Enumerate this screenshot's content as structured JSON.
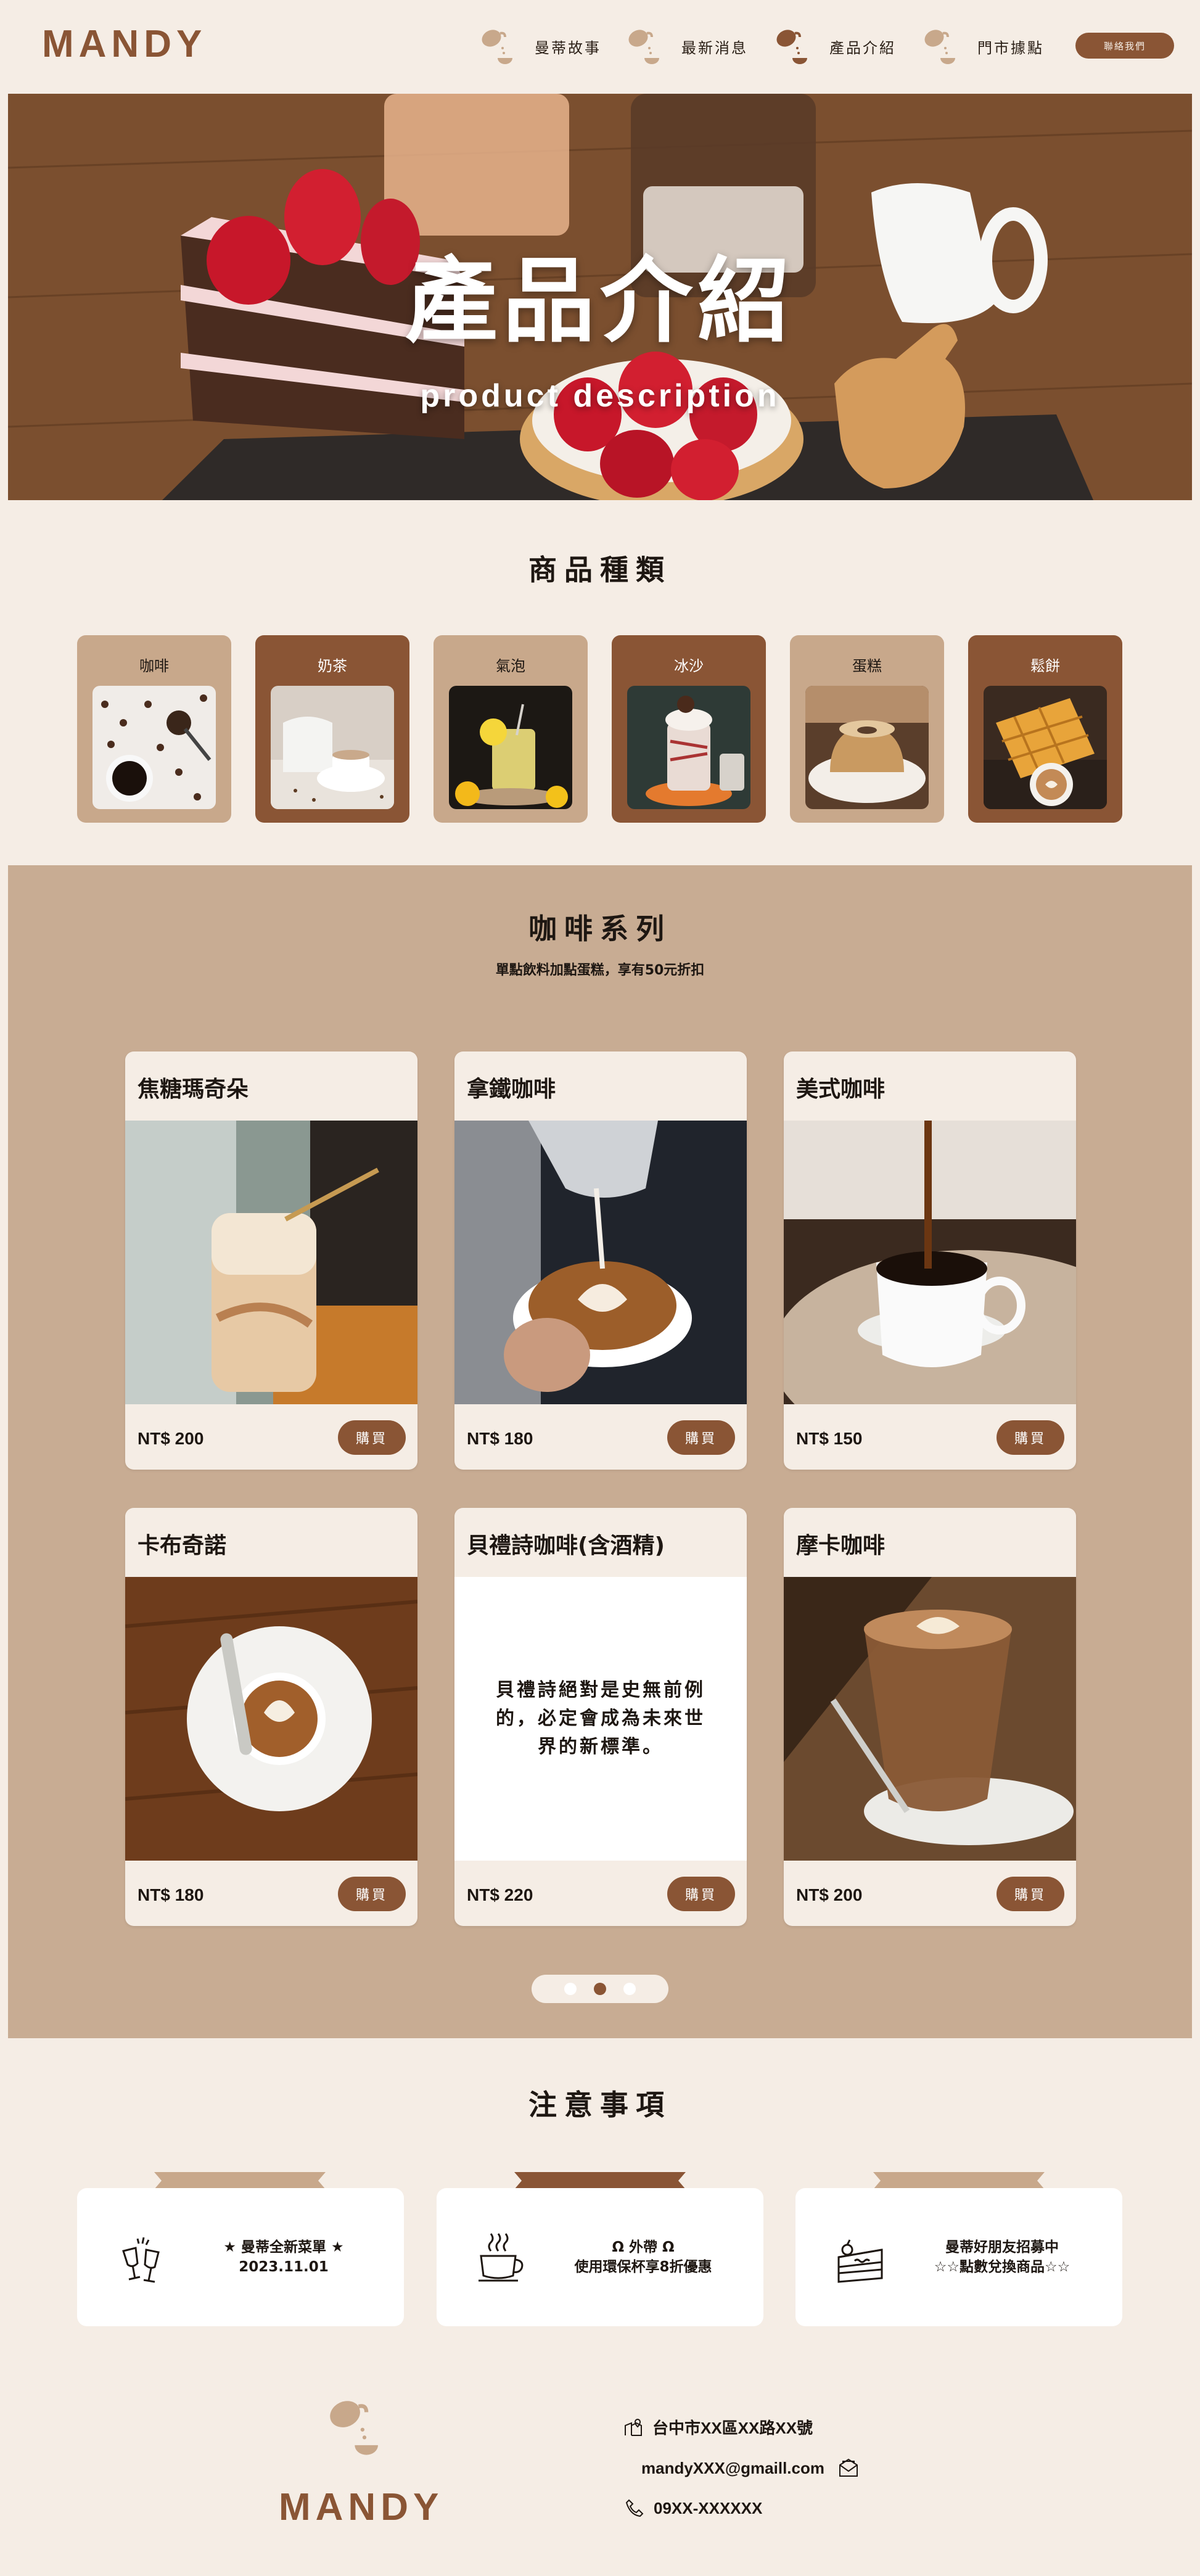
{
  "brand": {
    "logo": "MANDY"
  },
  "nav": {
    "items": [
      {
        "label": "曼蒂故事",
        "icon": "coffee-pour-icon"
      },
      {
        "label": "最新消息",
        "icon": "coffee-pour-icon"
      },
      {
        "label": "產品介紹",
        "icon": "coffee-pour-icon"
      },
      {
        "label": "門市據點",
        "icon": "coffee-pour-icon"
      }
    ],
    "contact_label": "聯絡我們"
  },
  "hero": {
    "title": "產品介紹",
    "subtitle": "product description"
  },
  "categories": {
    "title": "商品種類",
    "items": [
      {
        "label": "咖啡",
        "style": "light"
      },
      {
        "label": "奶茶",
        "style": "dark"
      },
      {
        "label": "氣泡",
        "style": "light"
      },
      {
        "label": "冰沙",
        "style": "dark"
      },
      {
        "label": "蛋糕",
        "style": "light"
      },
      {
        "label": "鬆餅",
        "style": "dark"
      }
    ]
  },
  "coffee": {
    "title": "咖啡系列",
    "note": "單點飲料加點蛋糕，享有50元折扣",
    "buy_label": "購買",
    "products": [
      {
        "name": "焦糖瑪奇朵",
        "price": "NT$ 200"
      },
      {
        "name": "拿鐵咖啡",
        "price": "NT$ 180"
      },
      {
        "name": "美式咖啡",
        "price": "NT$ 150"
      },
      {
        "name": "卡布奇諾",
        "price": "NT$ 180"
      },
      {
        "name": "貝禮詩咖啡(含酒精)",
        "price": "NT$ 220",
        "description": "貝禮詩絕對是史無前例的，必定會成為未來世界的新標準。"
      },
      {
        "name": "摩卡咖啡",
        "price": "NT$ 200"
      }
    ],
    "pager": {
      "pages": 3,
      "active": 2
    }
  },
  "notice": {
    "title": "注意事項",
    "items": [
      {
        "text": "★ 曼蒂全新菜單 ★\n2023.11.01",
        "icon": "cheers-glasses-icon"
      },
      {
        "text": "Ω 外帶 Ω\n使用環保杯享8折優惠",
        "icon": "coffee-cup-icon"
      },
      {
        "text": "曼蒂好朋友招募中\n☆☆點數兌換商品☆☆",
        "icon": "cake-slice-icon"
      }
    ]
  },
  "footer": {
    "logo": "MANDY",
    "address": "台中市XX區XX路XX號",
    "email": "mandyXXX@gmaill.com",
    "phone": "09XX-XXXXXX"
  },
  "colors": {
    "brand": "#8a5535",
    "background": "#f5ede5",
    "tan": "#c8ac93",
    "light_tan": "#c8a88b"
  }
}
